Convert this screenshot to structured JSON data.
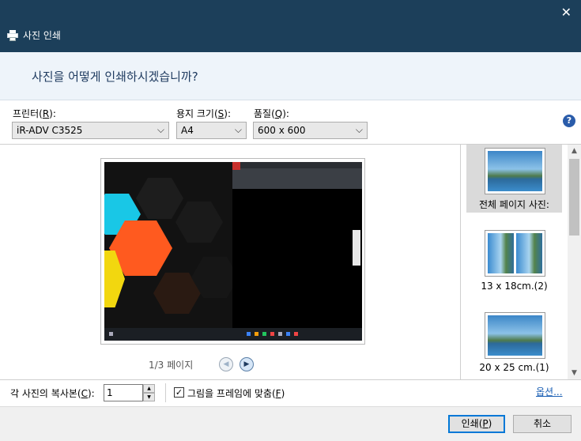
{
  "window": {
    "title": "사진 인쇄",
    "close_glyph": "✕"
  },
  "header": {
    "heading": "사진을 어떻게 인쇄하시겠습니까?"
  },
  "options": {
    "printer": {
      "label_pre": "프린터(",
      "hotkey": "R",
      "label_post": "):",
      "value": "iR-ADV C3525"
    },
    "paper_size": {
      "label_pre": "용지 크기(",
      "hotkey": "S",
      "label_post": "):",
      "value": "A4"
    },
    "quality": {
      "label_pre": "품질(",
      "hotkey": "Q",
      "label_post": "):",
      "value": "600 x 600"
    },
    "help_glyph": "?",
    "chevron_glyph": "⌵"
  },
  "preview": {
    "page_indicator": "1/3 페이지",
    "prev_glyph": "◀",
    "next_glyph": "▶"
  },
  "layouts": [
    {
      "label": "전체 페이지 사진:",
      "selected": true
    },
    {
      "label": "13 x 18cm.(2)",
      "selected": false
    },
    {
      "label": "20 x 25 cm.(1)",
      "selected": false
    }
  ],
  "bottom": {
    "copies_pre": "각 사진의 복사본(",
    "copies_hotkey": "C",
    "copies_post": "):",
    "copies_value": "1",
    "fit_checked_glyph": "✓",
    "fit_pre": "그림을 프레임에 맞춤(",
    "fit_hotkey": "F",
    "fit_post": ")",
    "options_link": "옵션..."
  },
  "footer": {
    "print_pre": "인쇄(",
    "print_hotkey": "P",
    "print_post": ")",
    "cancel": "취소"
  },
  "colors": {
    "titlebar": "#1c3f5a",
    "header_bg": "#eef4fa",
    "accent": "#0078d7"
  }
}
